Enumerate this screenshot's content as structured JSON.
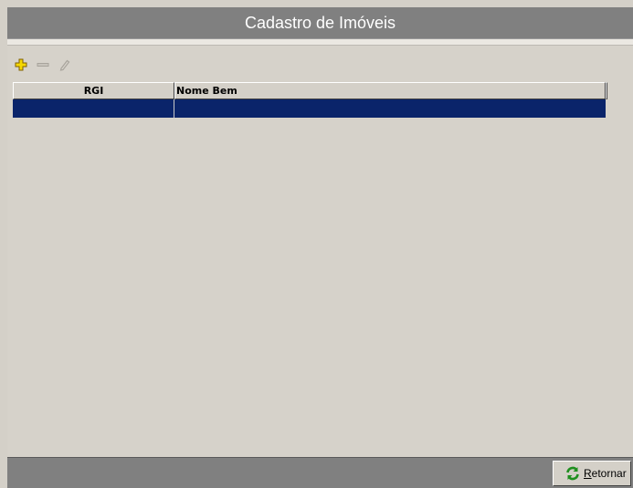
{
  "window": {
    "title": "Cadastro de Imóveis"
  },
  "toolbar": {
    "add_icon": "plus-icon",
    "remove_icon": "minus-icon",
    "edit_icon": "pencil-icon"
  },
  "grid": {
    "columns": [
      "RGI",
      "Nome Bem"
    ],
    "rows": [
      {
        "rgi": "",
        "nome_bem": ""
      }
    ],
    "selected_row_color": "#0a246a"
  },
  "footer": {
    "retornar_label": "Retornar",
    "retornar_icon": "refresh-icon"
  },
  "colors": {
    "titlebar": "#808080",
    "background": "#d4d0c8",
    "add_icon": "#f0d000"
  }
}
